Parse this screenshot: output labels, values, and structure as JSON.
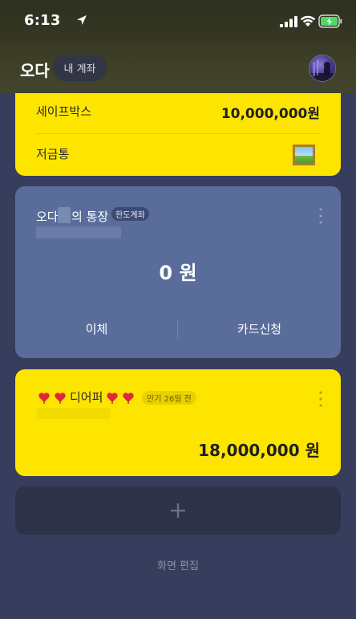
{
  "status_bar": {
    "time": "6:13"
  },
  "header": {
    "title": "오다",
    "my_account_label": "내 계좌"
  },
  "safebox_card": {
    "safebox_label": "세이프박스",
    "safebox_amount": "10,000,000원",
    "piggybank_label": "저금통"
  },
  "account_card": {
    "title_prefix": "오다",
    "title_suffix": "의 통장",
    "badge": "한도계좌",
    "balance": "0 원",
    "transfer_label": "이체",
    "card_apply_label": "카드신청"
  },
  "savings_card": {
    "title": "디어퍼",
    "badge": "만기 26일 전",
    "amount": "18,000,000 원"
  },
  "footer": {
    "edit_label": "화면 편집"
  },
  "colors": {
    "background": "#373d5c",
    "yellow": "#fee500",
    "blue_card": "#5a6d9a",
    "add_card": "#2d3249"
  }
}
